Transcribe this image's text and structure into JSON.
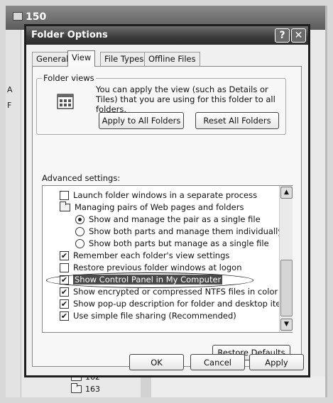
{
  "background": {
    "window_title": "150",
    "side_letters": [
      "A",
      "F"
    ],
    "list_items": [
      "162",
      "163"
    ]
  },
  "dialog": {
    "title": "Folder Options",
    "help_glyph": "?",
    "close_glyph": "✕",
    "tabs": [
      {
        "label": "General"
      },
      {
        "label": "View",
        "active": true
      },
      {
        "label": "File Types"
      },
      {
        "label": "Offline Files"
      }
    ],
    "folder_views": {
      "label": "Folder views",
      "description": "You can apply the view (such as Details or Tiles) that you are using for this folder to all folders.",
      "apply_button": "Apply to All Folders",
      "reset_button": "Reset All Folders"
    },
    "advanced": {
      "label": "Advanced settings:",
      "items": [
        {
          "type": "checkbox",
          "checked": false,
          "label": "Launch folder windows in a separate process"
        },
        {
          "type": "folder",
          "label": "Managing pairs of Web pages and folders"
        },
        {
          "type": "radio",
          "checked": true,
          "label": "Show and manage the pair as a single file"
        },
        {
          "type": "radio",
          "checked": false,
          "label": "Show both parts and manage them individually"
        },
        {
          "type": "radio",
          "checked": false,
          "label": "Show both parts but manage as a single file"
        },
        {
          "type": "checkbox",
          "checked": true,
          "label": "Remember each folder's view settings"
        },
        {
          "type": "checkbox",
          "checked": false,
          "label": "Restore previous folder windows at logon"
        },
        {
          "type": "checkbox",
          "checked": true,
          "label": "Show Control Panel in My Computer",
          "highlighted": true
        },
        {
          "type": "checkbox",
          "checked": true,
          "label": "Show encrypted or compressed NTFS files in color"
        },
        {
          "type": "checkbox",
          "checked": true,
          "label": "Show pop-up description for folder and desktop items"
        },
        {
          "type": "checkbox",
          "checked": true,
          "label": "Use simple file sharing (Recommended)"
        }
      ],
      "restore_defaults": "Restore Defaults"
    },
    "footer": {
      "ok": "OK",
      "cancel": "Cancel",
      "apply": "Apply"
    },
    "check_glyph": "✔"
  }
}
